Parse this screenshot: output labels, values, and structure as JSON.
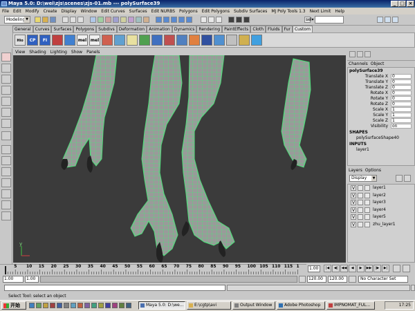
{
  "window": {
    "title": "Maya 5.0: D:\\wei\\zjs\\scenes\\zjs-01.mb  ---  polySurface39"
  },
  "menubar": [
    "File",
    "Edit",
    "Modify",
    "Create",
    "Display",
    "Window",
    "Edit Curves",
    "Surfaces",
    "Edit NURBS",
    "Polygons",
    "Edit Polygons",
    "Subdiv Surfaces",
    "MJ Poly Tools 1.3",
    "Next Limit",
    "Help"
  ],
  "statusline": {
    "mode": "Modeling",
    "sel_label": "sel▾"
  },
  "shelf_tabs": [
    "General",
    "Curves",
    "Surfaces",
    "Polygons",
    "Subdivs",
    "Deformation",
    "Animation",
    "Dynamics",
    "Rendering",
    "PaintEffects",
    "Cloth",
    "Fluids",
    "Fur",
    "Custom"
  ],
  "shelf_active": "Custom",
  "shelf_icons": [
    "Hio",
    "CP",
    "FI",
    "",
    "",
    "mel",
    "mel",
    "",
    "",
    "",
    "",
    "",
    "",
    "",
    "",
    "",
    "",
    "",
    "",
    ""
  ],
  "viewport": {
    "menu": [
      "View",
      "Shading",
      "Lighting",
      "Show",
      "Panels"
    ],
    "background": "#3b3b3b",
    "wire_color": "#4ee07a",
    "mesh_color": "#9a9a9a",
    "axis_label": "y"
  },
  "channelbox": {
    "tabs": [
      "Channels",
      "Object"
    ],
    "object": "polySurface39",
    "attributes": [
      {
        "name": "Translate X",
        "value": "0"
      },
      {
        "name": "Translate Y",
        "value": "0"
      },
      {
        "name": "Translate Z",
        "value": "0"
      },
      {
        "name": "Rotate X",
        "value": "0"
      },
      {
        "name": "Rotate Y",
        "value": "0"
      },
      {
        "name": "Rotate Z",
        "value": "0"
      },
      {
        "name": "Scale X",
        "value": "1"
      },
      {
        "name": "Scale Y",
        "value": "1"
      },
      {
        "name": "Scale Z",
        "value": "1"
      },
      {
        "name": "Visibility",
        "value": "on"
      }
    ],
    "shapes_label": "SHAPES",
    "shape": "polySurfaceShape40",
    "inputs_label": "INPUTS",
    "input": "layer1"
  },
  "layers": {
    "tabs": [
      "Layers",
      "Options"
    ],
    "display": "Display",
    "items": [
      {
        "v": "V",
        "name": "layer1"
      },
      {
        "v": "V",
        "name": "layer2"
      },
      {
        "v": "V",
        "name": "layer3"
      },
      {
        "v": "V",
        "name": "layer4"
      },
      {
        "v": "V",
        "name": "layer5"
      },
      {
        "v": "V",
        "name": "zhu_layer1"
      }
    ]
  },
  "timeslider": {
    "ticks": [
      "5",
      "10",
      "15",
      "20",
      "25",
      "30",
      "35",
      "40",
      "45",
      "50",
      "55",
      "60",
      "65",
      "70",
      "75",
      "80",
      "85",
      "90",
      "95",
      "100",
      "105",
      "110",
      "115",
      "1"
    ],
    "current": "1.00"
  },
  "range": {
    "start": "1.00",
    "inner_start": "1.00",
    "inner_end": "120.00",
    "end": "120.00",
    "charset": "No Character Set"
  },
  "helpline": "Select Tool: select an object",
  "taskbar": {
    "start": "开始",
    "tasks": [
      "Maya 5.0: D:\\we...",
      "E:\\cgtp\\avi",
      "Output Window",
      "Adobe Photoshop",
      "IMPNOMAT_FUL..."
    ],
    "active": 0,
    "clock": "17:25"
  }
}
